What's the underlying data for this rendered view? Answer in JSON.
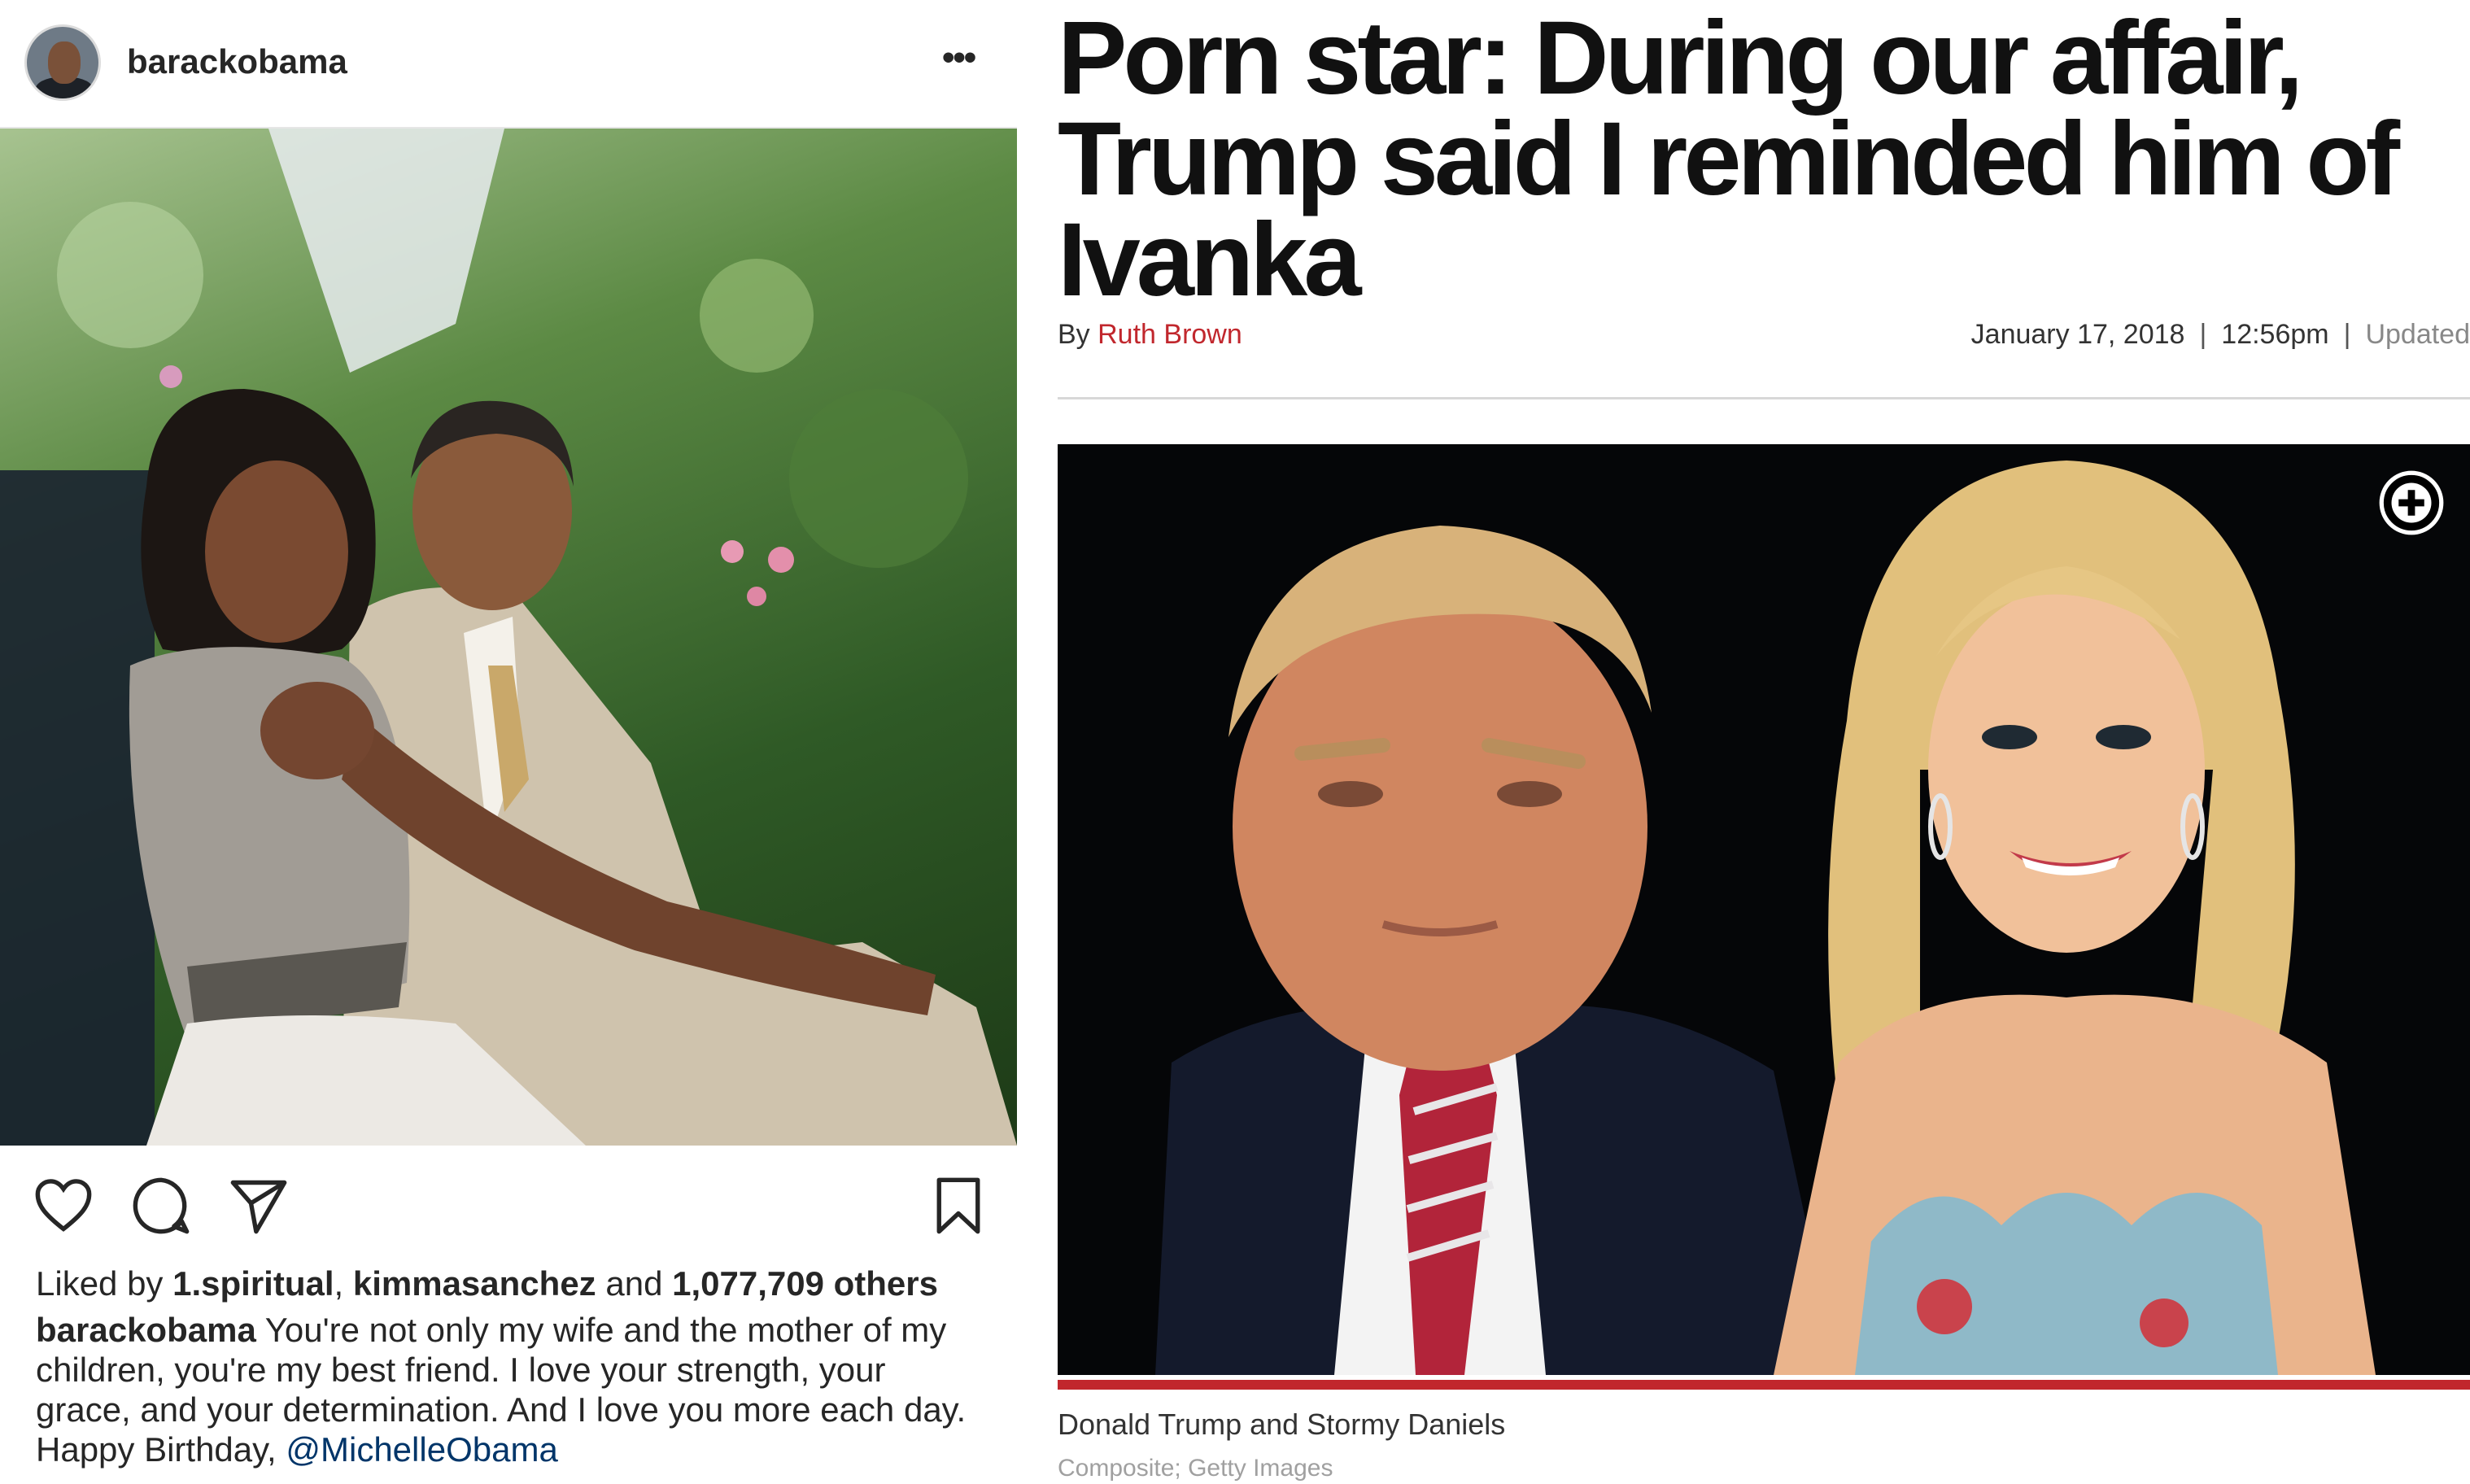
{
  "instagram": {
    "username": "barackobama",
    "more_icon": "more-icon",
    "actions": [
      "heart-icon",
      "comment-icon",
      "share-icon",
      "bookmark-icon"
    ],
    "likes": {
      "prefix": "Liked by ",
      "user1": "1.spiritual",
      "comma": ", ",
      "user2": "kimmasanchez",
      "and": " and ",
      "count": "1,077,709 others"
    },
    "caption": {
      "user": "barackobama",
      "text": " You're not only my wife and the mother of my children, you're my best friend. I love your strength, your grace, and your determination. And I love you more each day. Happy Birthday, ",
      "mention": "@MichelleObama"
    }
  },
  "article": {
    "headline": "Porn star: During our affair, Trump said I reminded him of Ivanka",
    "byline_prefix": "By ",
    "author": "Ruth Brown",
    "date": "January 17, 2018",
    "separator": "|",
    "time": "12:56pm",
    "updated": "Updated",
    "expand_icon": "plus-circle-icon",
    "photo_caption": "Donald Trump and Stormy Daniels",
    "photo_credit": "Composite; Getty Images",
    "accent_color": "#c1272d"
  }
}
